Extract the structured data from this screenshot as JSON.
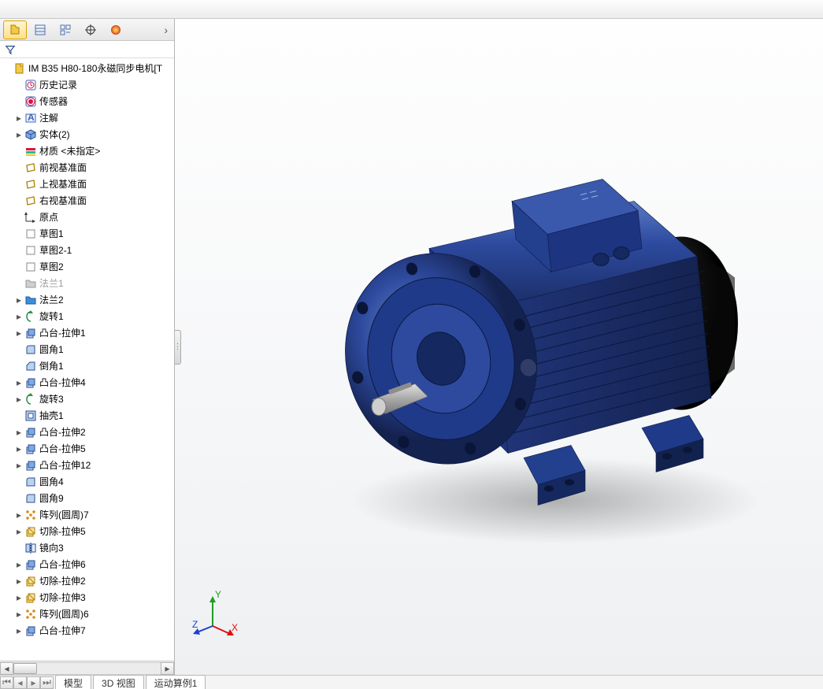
{
  "colors": {
    "motor_body": "#2d4a9e",
    "motor_shadow": "#1a2d66",
    "motor_highlight": "#5a7ac6",
    "shaft": "#b8b8b8",
    "fan_cover": "#1a1a1a"
  },
  "tabs": {
    "overflow_glyph": "›"
  },
  "filter": {},
  "root": {
    "label": "IM B35 H80-180永磁同步电机[T"
  },
  "tree": [
    {
      "icon": "history",
      "label": "历史记录",
      "caret": false
    },
    {
      "icon": "sensor",
      "label": "传感器",
      "caret": false
    },
    {
      "icon": "annot",
      "label": "注解",
      "caret": true
    },
    {
      "icon": "solid",
      "label": "实体(2)",
      "caret": true
    },
    {
      "icon": "material",
      "label": "材质 <未指定>",
      "caret": false
    },
    {
      "icon": "plane",
      "label": "前视基准面",
      "caret": false
    },
    {
      "icon": "plane",
      "label": "上视基准面",
      "caret": false
    },
    {
      "icon": "plane",
      "label": "右视基准面",
      "caret": false
    },
    {
      "icon": "origin",
      "label": "原点",
      "caret": false
    },
    {
      "icon": "sketch",
      "label": "草图1",
      "caret": false
    },
    {
      "icon": "sketch",
      "label": "草图2-1",
      "caret": false
    },
    {
      "icon": "sketch",
      "label": "草图2",
      "caret": false
    },
    {
      "icon": "folder-g",
      "label": "法兰1",
      "caret": false,
      "grey": true
    },
    {
      "icon": "folder",
      "label": "法兰2",
      "caret": true
    },
    {
      "icon": "revolve",
      "label": "旋转1",
      "caret": true
    },
    {
      "icon": "extrude",
      "label": "凸台-拉伸1",
      "caret": true
    },
    {
      "icon": "fillet",
      "label": "圆角1",
      "caret": false
    },
    {
      "icon": "chamfer",
      "label": "倒角1",
      "caret": false
    },
    {
      "icon": "extrude",
      "label": "凸台-拉伸4",
      "caret": true
    },
    {
      "icon": "revolve",
      "label": "旋转3",
      "caret": true
    },
    {
      "icon": "shell",
      "label": "抽壳1",
      "caret": false
    },
    {
      "icon": "extrude",
      "label": "凸台-拉伸2",
      "caret": true
    },
    {
      "icon": "extrude",
      "label": "凸台-拉伸5",
      "caret": true
    },
    {
      "icon": "extrude",
      "label": "凸台-拉伸12",
      "caret": true
    },
    {
      "icon": "fillet",
      "label": "圆角4",
      "caret": false
    },
    {
      "icon": "fillet",
      "label": "圆角9",
      "caret": false
    },
    {
      "icon": "pattern",
      "label": "阵列(圆周)7",
      "caret": true
    },
    {
      "icon": "cut",
      "label": "切除-拉伸5",
      "caret": true
    },
    {
      "icon": "mirror",
      "label": "镜向3",
      "caret": false
    },
    {
      "icon": "extrude",
      "label": "凸台-拉伸6",
      "caret": true
    },
    {
      "icon": "cut",
      "label": "切除-拉伸2",
      "caret": true
    },
    {
      "icon": "cut",
      "label": "切除-拉伸3",
      "caret": true
    },
    {
      "icon": "pattern",
      "label": "阵列(圆周)6",
      "caret": true
    },
    {
      "icon": "extrude",
      "label": "凸台-拉伸7",
      "caret": true
    }
  ],
  "bottom_tabs": [
    "模型",
    "3D 视图",
    "运动算例1"
  ],
  "triad": {
    "x": "X",
    "y": "Y",
    "z": "Z"
  }
}
